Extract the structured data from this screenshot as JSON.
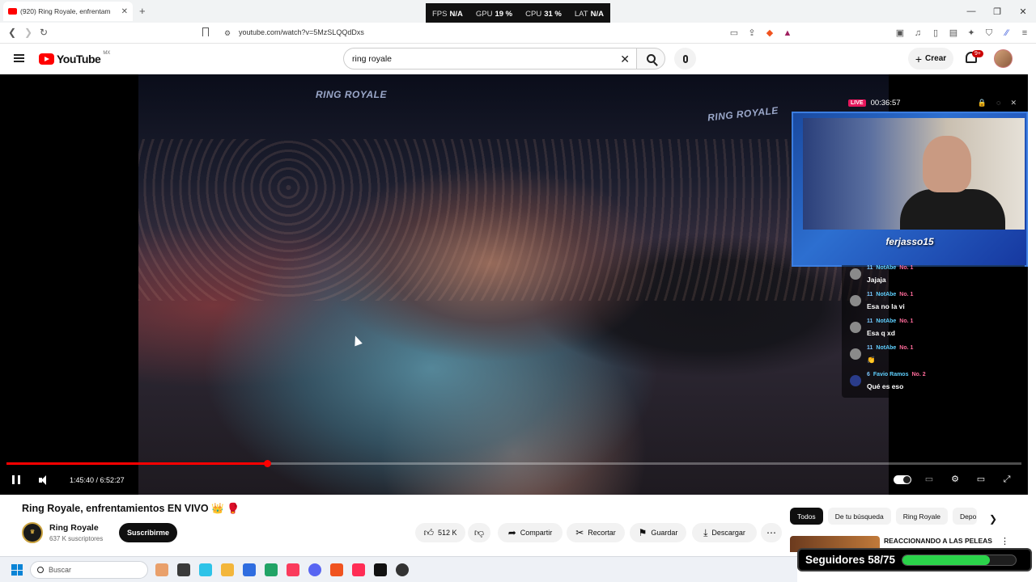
{
  "browser": {
    "tab_title": "(920) Ring Royale, enfrentam",
    "url": "youtube.com/watch?v=5MzSLQQdDxs"
  },
  "perf": {
    "fps_label": "FPS",
    "fps_value": "N/A",
    "gpu_label": "GPU",
    "gpu_value": "19 %",
    "cpu_label": "CPU",
    "cpu_value": "31 %",
    "lat_label": "LAT",
    "lat_value": "N/A"
  },
  "youtube": {
    "logo_text": "YouTube",
    "region": "MX",
    "search_value": "ring royale",
    "create_label": "Crear",
    "notif_badge": "9+"
  },
  "video": {
    "banner_left": "RING ROYALE",
    "banner_right": "RING ROYALE",
    "progress_fraction": 0.257,
    "time_current": "1:45:40",
    "time_sep": " / ",
    "time_total": "6:52:27"
  },
  "stream": {
    "live_tag": "LIVE",
    "live_time": "00:36:57",
    "streamer": "ferjasso15"
  },
  "chat": [
    {
      "level": "11",
      "name": "NotAbe",
      "rank": "No. 1",
      "text": "Jajaja"
    },
    {
      "level": "11",
      "name": "NotAbe",
      "rank": "No. 1",
      "text": "Esa no la vi"
    },
    {
      "level": "11",
      "name": "NotAbe",
      "rank": "No. 1",
      "text": "Esa q xd"
    },
    {
      "level": "11",
      "name": "NotAbe",
      "rank": "No. 1",
      "text": "👏"
    },
    {
      "level": "6",
      "name": "Favio Ramos",
      "rank": "No. 2",
      "text": "Qué es eso"
    }
  ],
  "details": {
    "title": "Ring Royale, enfrentamientos EN VIVO 👑 🥊",
    "channel_name": "Ring Royale",
    "channel_subs": "637 K suscriptores",
    "subscribe": "Suscribirme",
    "likes": "512 K",
    "share": "Compartir",
    "clip": "Recortar",
    "save": "Guardar",
    "download": "Descargar"
  },
  "sidebar": {
    "chips": [
      "Todos",
      "De tu búsqueda",
      "Ring Royale",
      "Depo"
    ],
    "rec_title": "REACCIONANDO A LAS PELEAS"
  },
  "followers": {
    "label": "Seguidores 58/75",
    "fraction": 0.773
  },
  "taskbar": {
    "search_placeholder": "Buscar"
  }
}
